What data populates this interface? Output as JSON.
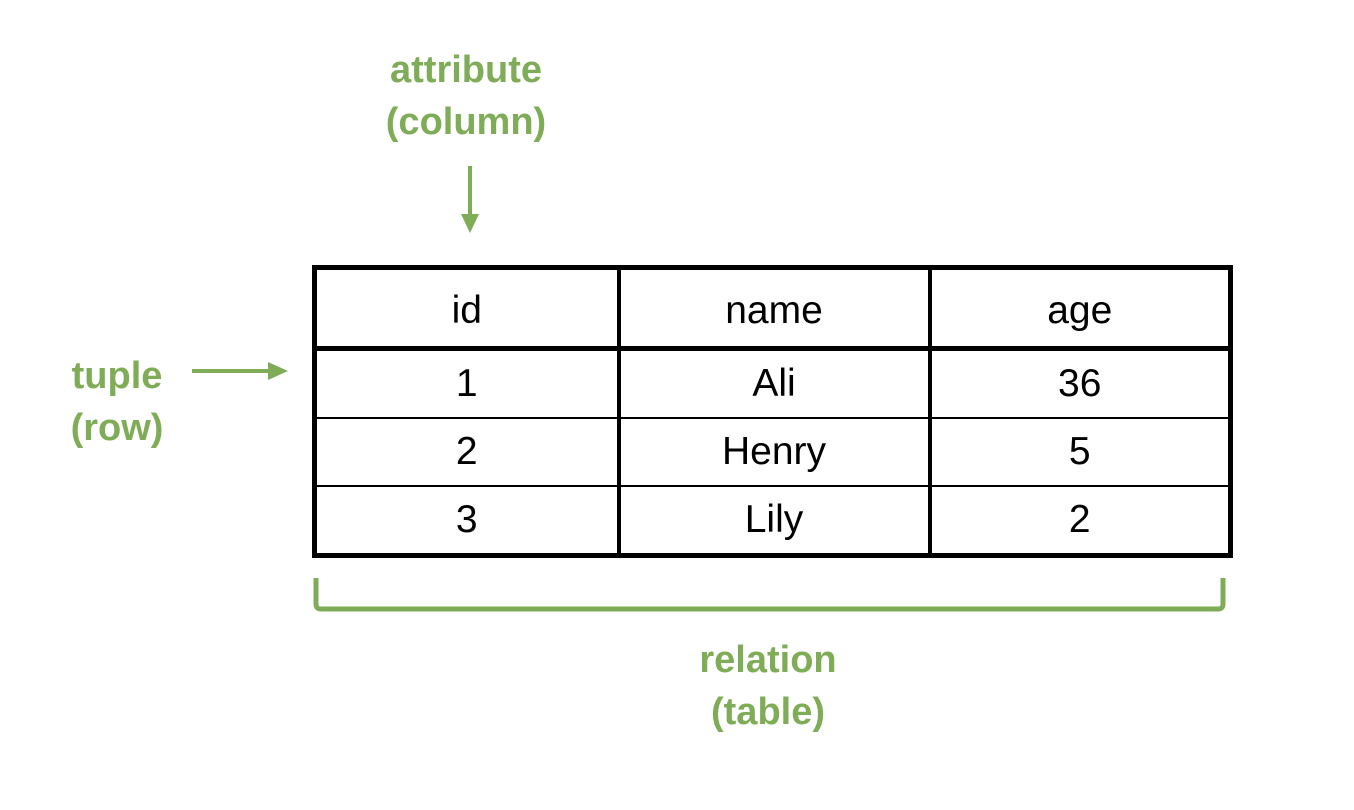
{
  "labels": {
    "attribute": "attribute",
    "attribute_sub": "(column)",
    "tuple": "tuple",
    "tuple_sub": "(row)",
    "relation": "relation",
    "relation_sub": "(table)"
  },
  "colors": {
    "annotation": "#7fac57",
    "table_border": "#000000",
    "text": "#000000"
  },
  "table": {
    "columns": [
      "id",
      "name",
      "age"
    ],
    "rows": [
      [
        "1",
        "Ali",
        "36"
      ],
      [
        "2",
        "Henry",
        "5"
      ],
      [
        "3",
        "Lily",
        "2"
      ]
    ]
  }
}
